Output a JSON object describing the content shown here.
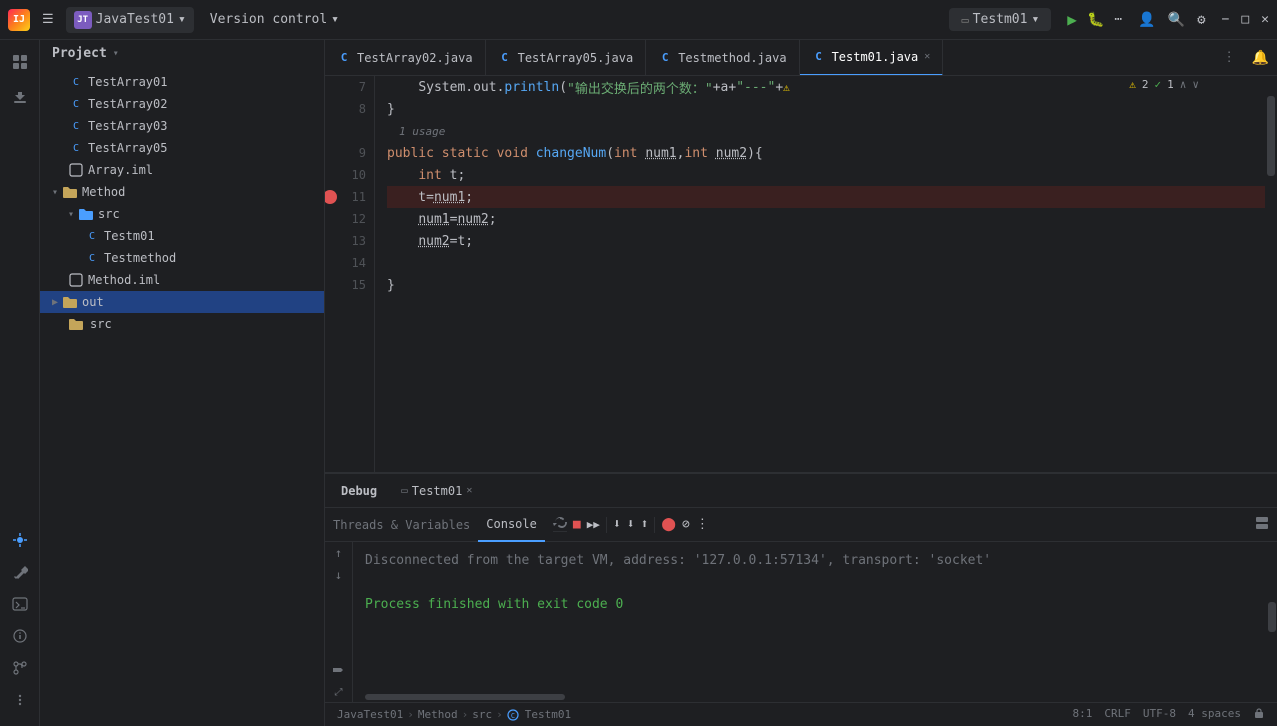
{
  "titleBar": {
    "logo": "IJ",
    "projectName": "JavaTest01",
    "versionControl": "Version control",
    "runConfig": "Testm01",
    "menuIcon": "☰",
    "chevronDown": "▾",
    "runBtn": "▶",
    "debugBtn": "🐛",
    "moreBtn": "⋯",
    "profileBtn": "👤",
    "searchBtn": "🔍",
    "settingsBtn": "⚙",
    "minBtn": "−",
    "maxBtn": "□",
    "closeBtn": "✕"
  },
  "sidebar": {
    "header": "Project",
    "chevron": "▾"
  },
  "projectTree": {
    "items": [
      {
        "id": "testarray01",
        "label": "TestArray01",
        "indent": 0,
        "type": "java",
        "expanded": false
      },
      {
        "id": "testarray02",
        "label": "TestArray02",
        "indent": 0,
        "type": "java",
        "expanded": false
      },
      {
        "id": "testarray03",
        "label": "TestArray03",
        "indent": 0,
        "type": "java",
        "expanded": false
      },
      {
        "id": "testarray05",
        "label": "TestArray05",
        "indent": 0,
        "type": "java",
        "expanded": false
      },
      {
        "id": "array-iml",
        "label": "Array.iml",
        "indent": 0,
        "type": "iml",
        "expanded": false
      },
      {
        "id": "method",
        "label": "Method",
        "indent": 0,
        "type": "folder",
        "expanded": true
      },
      {
        "id": "src",
        "label": "src",
        "indent": 1,
        "type": "folder",
        "expanded": true
      },
      {
        "id": "testm01",
        "label": "Testm01",
        "indent": 2,
        "type": "java",
        "expanded": false
      },
      {
        "id": "testmethod",
        "label": "Testmethod",
        "indent": 2,
        "type": "java",
        "expanded": false
      },
      {
        "id": "method-iml",
        "label": "Method.iml",
        "indent": 1,
        "type": "iml",
        "expanded": false
      },
      {
        "id": "out",
        "label": "out",
        "indent": 0,
        "type": "folder",
        "expanded": false,
        "selected": true
      },
      {
        "id": "src2",
        "label": "src",
        "indent": 0,
        "type": "folder",
        "expanded": false
      }
    ]
  },
  "tabs": [
    {
      "id": "testarray02",
      "label": "TestArray02.java",
      "active": false,
      "icon": "C"
    },
    {
      "id": "testarray05",
      "label": "TestArray05.java",
      "active": false,
      "icon": "C"
    },
    {
      "id": "testmethod",
      "label": "Testmethod.java",
      "active": false,
      "icon": "C"
    },
    {
      "id": "testm01",
      "label": "Testm01.java",
      "active": true,
      "icon": "C",
      "closable": true
    }
  ],
  "code": {
    "lines": [
      {
        "num": 7,
        "content": "    System.out.println(\"输出交换后的两个数：\"+a+\"---\"+b",
        "hasError": false,
        "isBreakpoint": false,
        "isCurrent": false
      },
      {
        "num": 8,
        "content": "}",
        "hasError": false,
        "isBreakpoint": false,
        "isCurrent": false
      },
      {
        "num": 9,
        "content": "public static void changeNum(int num1,int num2){",
        "hasError": false,
        "isBreakpoint": false,
        "isCurrent": false
      },
      {
        "num": 10,
        "content": "    int t;",
        "hasError": false,
        "isBreakpoint": false,
        "isCurrent": false
      },
      {
        "num": 11,
        "content": "    t=num1;",
        "hasError": false,
        "isBreakpoint": true,
        "isCurrent": true
      },
      {
        "num": 12,
        "content": "    num1=num2;",
        "hasError": false,
        "isBreakpoint": false,
        "isCurrent": false
      },
      {
        "num": 13,
        "content": "    num2=t;",
        "hasError": false,
        "isBreakpoint": false,
        "isCurrent": false
      },
      {
        "num": 14,
        "content": "",
        "hasError": false,
        "isBreakpoint": false,
        "isCurrent": false
      },
      {
        "num": 15,
        "content": "}",
        "hasError": false,
        "isBreakpoint": false,
        "isCurrent": false
      }
    ],
    "usageHint": "1 usage",
    "errorCount": 2,
    "warningCount": 1
  },
  "bottomPanel": {
    "debugLabel": "Debug",
    "runConfigLabel": "Testm01",
    "closeLabel": "✕",
    "tabs": [
      {
        "id": "threads",
        "label": "Threads & Variables",
        "active": false
      },
      {
        "id": "console",
        "label": "Console",
        "active": true
      }
    ],
    "toolbar": {
      "rerunBtn": "↺",
      "stopBtn": "■",
      "resumeBtn": "▶▶",
      "stepOverBtn": "↓",
      "stepIntoBtn": "↓",
      "stepOutBtn": "↑",
      "muteBtn": "🔴",
      "clearBtn": "⊘",
      "moreBtn": "⋮"
    },
    "consoleLines": [
      {
        "text": "Disconnected from the target VM, address: '127.0.0.1:57134', transport: 'socket'",
        "type": "gray"
      },
      {
        "text": "",
        "type": "normal"
      },
      {
        "text": "Process finished with exit code 0",
        "type": "green"
      }
    ]
  },
  "statusBar": {
    "breadcrumb": [
      {
        "label": "JavaTest01"
      },
      {
        "label": "Method"
      },
      {
        "label": "src"
      },
      {
        "label": "Testm01"
      }
    ],
    "position": "8:1",
    "lineEnding": "CRLF",
    "encoding": "UTF-8",
    "indent": "4 spaces"
  }
}
